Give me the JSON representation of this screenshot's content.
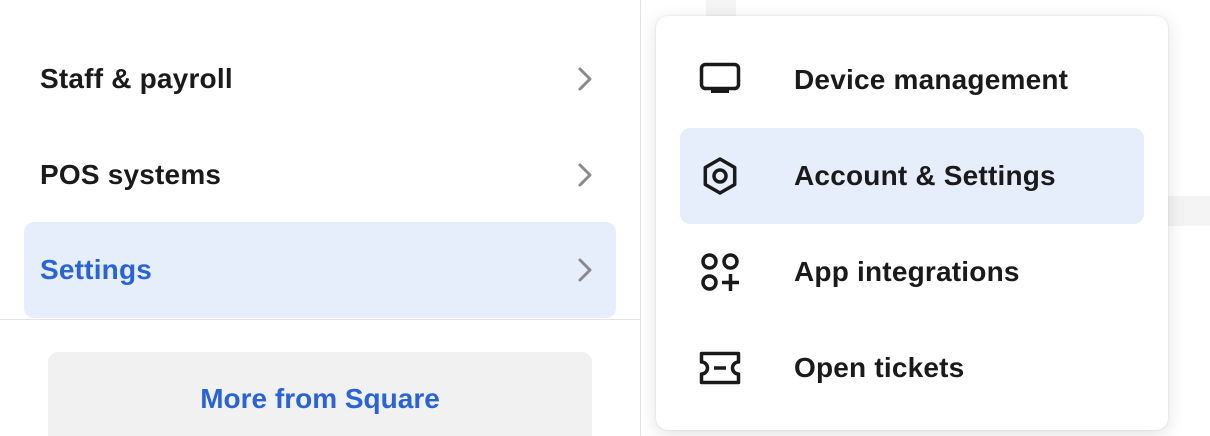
{
  "left_nav": {
    "items": [
      {
        "label": "Staff & payroll",
        "active": false
      },
      {
        "label": "POS systems",
        "active": false
      },
      {
        "label": "Settings",
        "active": true
      }
    ],
    "more_button_label": "More from Square"
  },
  "settings_menu": {
    "items": [
      {
        "label": "Device management",
        "icon": "monitor-icon",
        "active": false
      },
      {
        "label": "Account & Settings",
        "icon": "gear-icon",
        "active": true
      },
      {
        "label": "App integrations",
        "icon": "app-grid-plus-icon",
        "active": false
      },
      {
        "label": "Open tickets",
        "icon": "ticket-icon",
        "active": false
      }
    ]
  },
  "colors": {
    "accent": "#2a63d4",
    "active_bg": "#e6eefb",
    "text": "#1a1a1a",
    "chevron": "#8a8a8a"
  }
}
